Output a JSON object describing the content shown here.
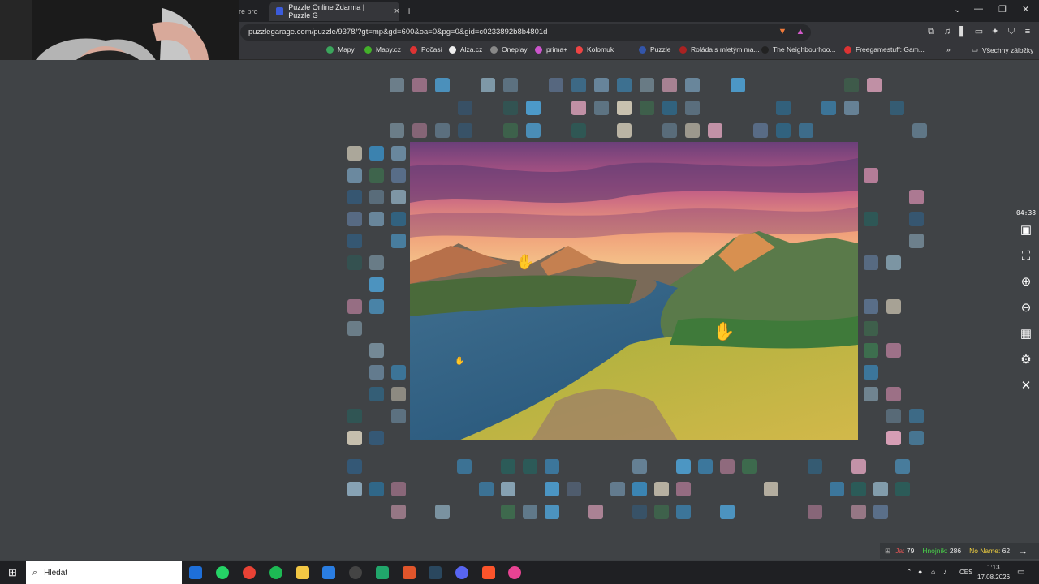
{
  "browser": {
    "tabs": [
      {
        "title": "re pro"
      },
      {
        "title": "Puzzle Online Zdarma | Puzzle G"
      }
    ],
    "url": "puzzlegarage.com/puzzle/9378/?gt=mp&gd=600&oa=0&pg=0&gid=c0233892b8b4801d",
    "bookmarks": [
      "Mapy",
      "Mapy.cz",
      "Počasí",
      "Alza.cz",
      "Oneplay",
      "prima+",
      "Kolomuk",
      "Puzzle",
      "Roláda s mletým ma...",
      "The Neighbourhoo...",
      "Freegamestuff: Gam..."
    ],
    "all_bookmarks": "Všechny záložky"
  },
  "game": {
    "timer": "04:38",
    "scores": [
      {
        "name": "Ja:",
        "value": "79",
        "color": "#e05555"
      },
      {
        "name": "Hnojník:",
        "value": "286",
        "color": "#49d049"
      },
      {
        "name": "No Name:",
        "value": "62",
        "color": "#f0d040"
      }
    ],
    "tools": [
      "image-icon",
      "fullscreen-icon",
      "zoom-in-icon",
      "zoom-out-icon",
      "grid-icon",
      "settings-icon",
      "close-icon"
    ]
  },
  "taskbar": {
    "search_placeholder": "Hledat",
    "language": "CES",
    "time": "1:13",
    "date": "17.08.2026"
  }
}
